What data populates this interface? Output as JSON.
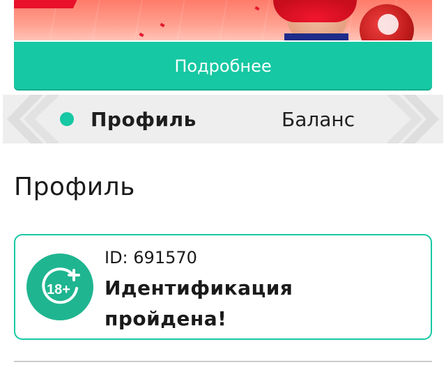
{
  "colors": {
    "accent": "#16c8a3",
    "badge": "#1fb590",
    "tab_strip_bg": "#eeeeee",
    "divider": "#cccccc"
  },
  "banner": {
    "image_description_icons": [
      "promo-player-image",
      "ball-icon"
    ]
  },
  "more_button": {
    "label": "Подробнее"
  },
  "tabs": {
    "items": [
      {
        "label": "Профиль",
        "active": true
      },
      {
        "label": "Баланс",
        "active": false
      }
    ]
  },
  "page": {
    "title": "Профиль"
  },
  "profile_card": {
    "id_text": "ID: 691570",
    "status": "Идентификация пройдена!",
    "badge_icon": "age-18-plus-icon",
    "badge_text": "18+"
  }
}
